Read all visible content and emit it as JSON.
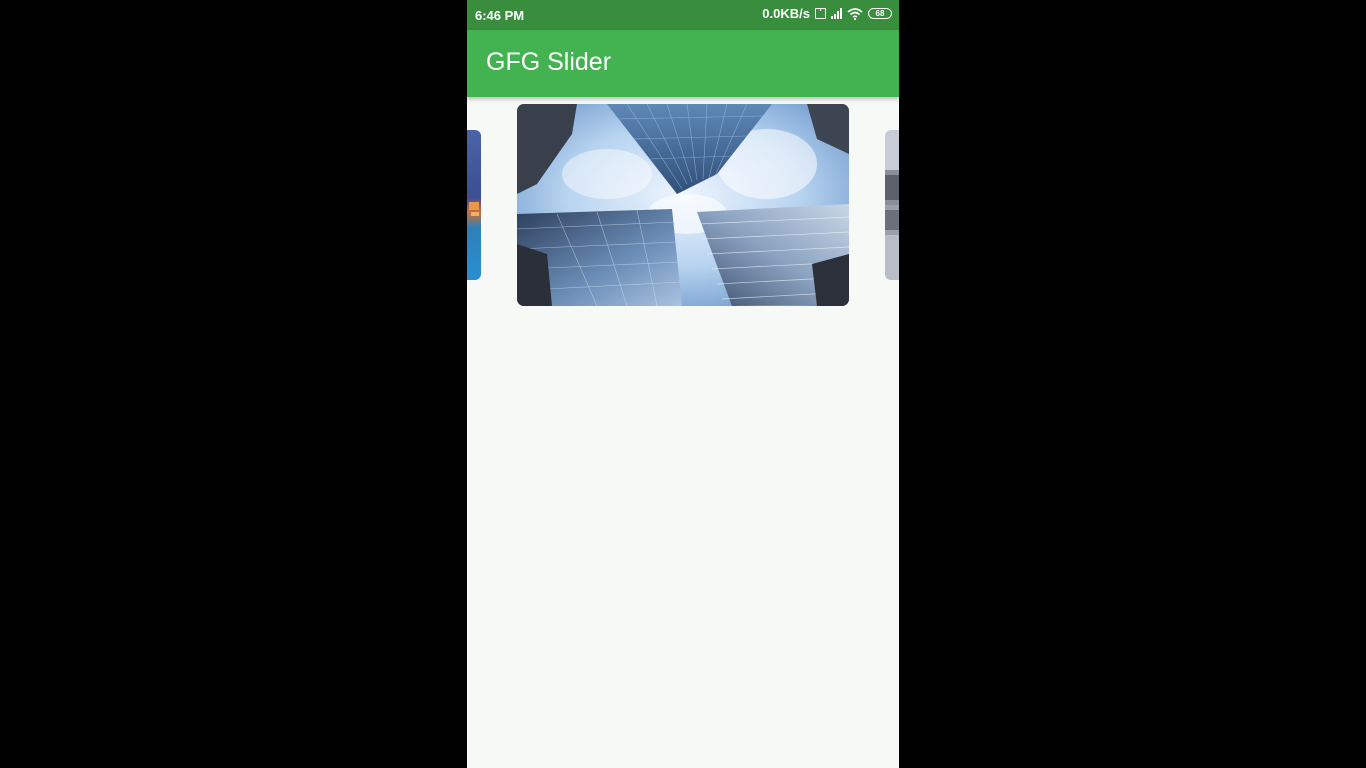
{
  "status_bar": {
    "time": "6:46 PM",
    "net_speed": "0.0KB/s",
    "battery": "68"
  },
  "app_bar": {
    "title": "GFG Slider"
  },
  "carousel": {
    "slides": [
      {
        "name": "city-waterfront-night"
      },
      {
        "name": "skyscrapers-looking-up"
      },
      {
        "name": "building-reflection"
      }
    ],
    "active_index": 1
  },
  "colors": {
    "status_bar": "#388e3c",
    "app_bar": "#43b352",
    "background": "#f7f9f7",
    "frame": "#000000"
  }
}
